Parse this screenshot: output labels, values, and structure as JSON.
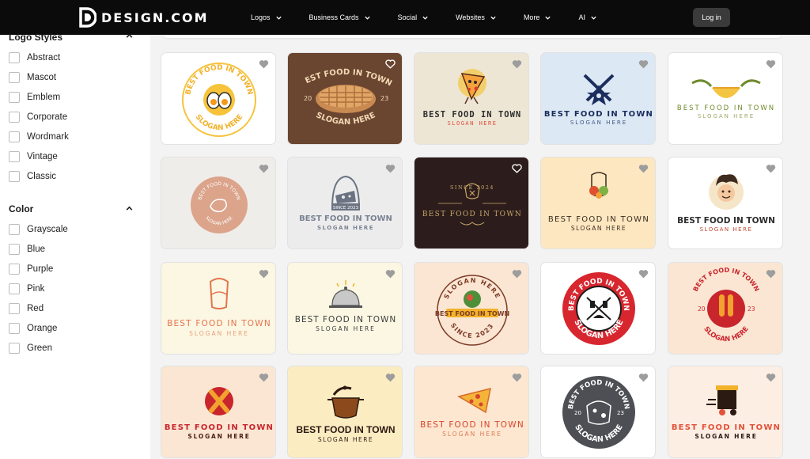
{
  "brand": {
    "name": "DESIGN.COM"
  },
  "nav": {
    "items": [
      "Logos",
      "Business Cards",
      "Social",
      "Websites",
      "More",
      "AI"
    ],
    "login_label": "Log in"
  },
  "sidebar": {
    "logo_styles": {
      "title": "Logo Styles",
      "options": [
        "Abstract",
        "Mascot",
        "Emblem",
        "Corporate",
        "Wordmark",
        "Vintage",
        "Classic"
      ]
    },
    "color": {
      "title": "Color",
      "options": [
        "Grayscale",
        "Blue",
        "Purple",
        "Pink",
        "Red",
        "Orange",
        "Green"
      ]
    }
  },
  "logos": {
    "l1": {
      "arc_top": "BEST FOOD IN TOWN",
      "arc_bottom": "SLOGAN HERE"
    },
    "l2": {
      "arc_top": "BEST FOOD IN TOWN",
      "year_left": "20",
      "year_right": "23",
      "bottom": "SLOGAN HERE"
    },
    "l3": {
      "name": "BEST FOOD IN TOWN",
      "slogan": "SLOGAN HERE"
    },
    "l4": {
      "name": "BEST FOOD IN TOWN",
      "slogan": "SLOGAN HERE"
    },
    "l5": {
      "name": "BEST FOOD IN TOWN",
      "slogan": "SLOGAN HERE"
    },
    "l6": {
      "name": "BEST FOOD IN TOWN",
      "slogan": "SLOGAN HERE"
    },
    "l7": {
      "since": "SINCE 2023",
      "name": "BEST FOOD IN TOWN",
      "slogan": "SLOGAN HERE"
    },
    "l8": {
      "since": "SINCE 2024",
      "name": "BEST FOOD IN TOWN"
    },
    "l9": {
      "name": "BEST FOOD IN TOWN",
      "slogan": "SLOGAN HERE"
    },
    "l10": {
      "name": "BEST FOOD IN TOWN",
      "slogan": "SLOGAN HERE"
    },
    "l11": {
      "name": "BEST FOOD IN TOWN",
      "slogan": "SLOGAN HERE"
    },
    "l12": {
      "name": "BEST FOOD IN TOWN",
      "slogan": "SLOGAN HERE"
    },
    "l13": {
      "arc_top": "SLOGAN HERE",
      "name": "BEST FOOD IN TOWN",
      "arc_bottom": "SINCE 2023"
    },
    "l14": {
      "arc_top": "BEST FOOD IN TOWN",
      "arc_bottom": "SLOGAN HERE"
    },
    "l15": {
      "arc_top": "BEST FOOD IN TOWN",
      "year_left": "20",
      "year_right": "23",
      "arc_bottom": "SLOGAN HERE"
    },
    "l16": {
      "name": "BEST FOOD IN TOWN",
      "slogan": "SLOGAN HERE"
    },
    "l17": {
      "name": "BEST FOOD IN TOWN",
      "slogan": "SLOGAN HERE"
    },
    "l18": {
      "name": "BEST FOOD IN TOWN",
      "slogan": "SLOGAN HERE"
    },
    "l19": {
      "arc_top": "BEST FOOD IN TOWN",
      "year_left": "20",
      "year_right": "23",
      "arc_bottom": "SLOGAN HERE"
    },
    "l20": {
      "name": "BEST FOOD IN TOWN",
      "slogan": "SLOGAN HERE"
    }
  }
}
